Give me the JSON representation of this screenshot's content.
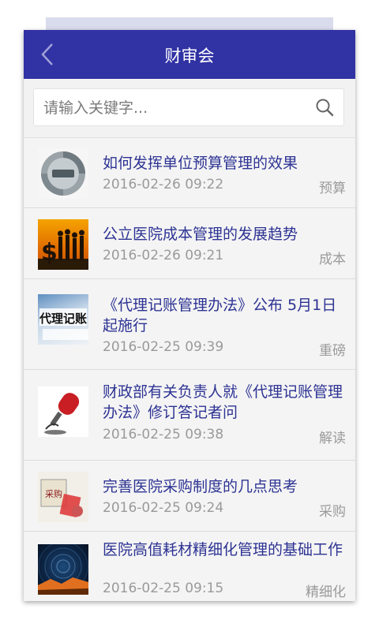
{
  "header": {
    "title": "财审会",
    "back_icon": "chevron-left-icon"
  },
  "search": {
    "placeholder": "请输入关键字...",
    "value": "",
    "icon": "search-icon"
  },
  "articles": [
    {
      "title": "如何发挥单位预算管理的效果",
      "date": "2016-02-26 09:22",
      "tag": "预算"
    },
    {
      "title": "公立医院成本管理的发展趋势",
      "date": "2016-02-26 09:21",
      "tag": "成本"
    },
    {
      "title": "《代理记账管理办法》公布 5月1日起施行",
      "date": "2016-02-25 09:39",
      "tag": "重磅",
      "thumb_text": "代理记账"
    },
    {
      "title": "财政部有关负责人就《代理记账管理办法》修订答记者问",
      "date": "2016-02-25 09:38",
      "tag": "解读"
    },
    {
      "title": "完善医院采购制度的几点思考",
      "date": "2016-02-25 09:24",
      "tag": "采购",
      "thumb_text": "采购"
    },
    {
      "title": "医院高值耗材精细化管理的基础工作",
      "date": "2016-02-25 09:15",
      "tag": "精细化"
    }
  ],
  "colors": {
    "header_bg": "#3132a4",
    "title_link": "#2d3393",
    "meta_text": "#9a9a9a"
  }
}
